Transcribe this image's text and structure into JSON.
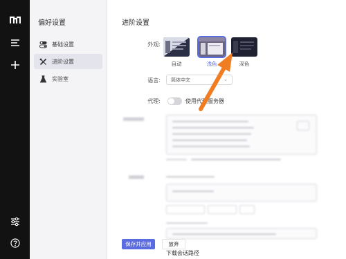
{
  "sidebar": {
    "title": "偏好设置",
    "items": [
      {
        "label": "基础设置",
        "icon": "toggle-icon"
      },
      {
        "label": "进阶设置",
        "icon": "tools-icon"
      },
      {
        "label": "实验室",
        "icon": "flask-icon"
      }
    ]
  },
  "main": {
    "title": "进阶设置",
    "appearance": {
      "label": "外观:",
      "options": [
        {
          "label": "自动"
        },
        {
          "label": "浅色"
        },
        {
          "label": "深色"
        }
      ]
    },
    "language": {
      "label": "语言:",
      "value": "简体中文"
    },
    "proxy": {
      "label": "代理:",
      "toggle_label": "使用代理服务器"
    },
    "bottom": {
      "save_label": "保存并应用",
      "discard_label": "放弃",
      "download_path_label": "下载会话路径"
    }
  },
  "colors": {
    "accent": "#5b6be0",
    "rail": "#121212",
    "annotation_arrow": "#f07d21"
  }
}
